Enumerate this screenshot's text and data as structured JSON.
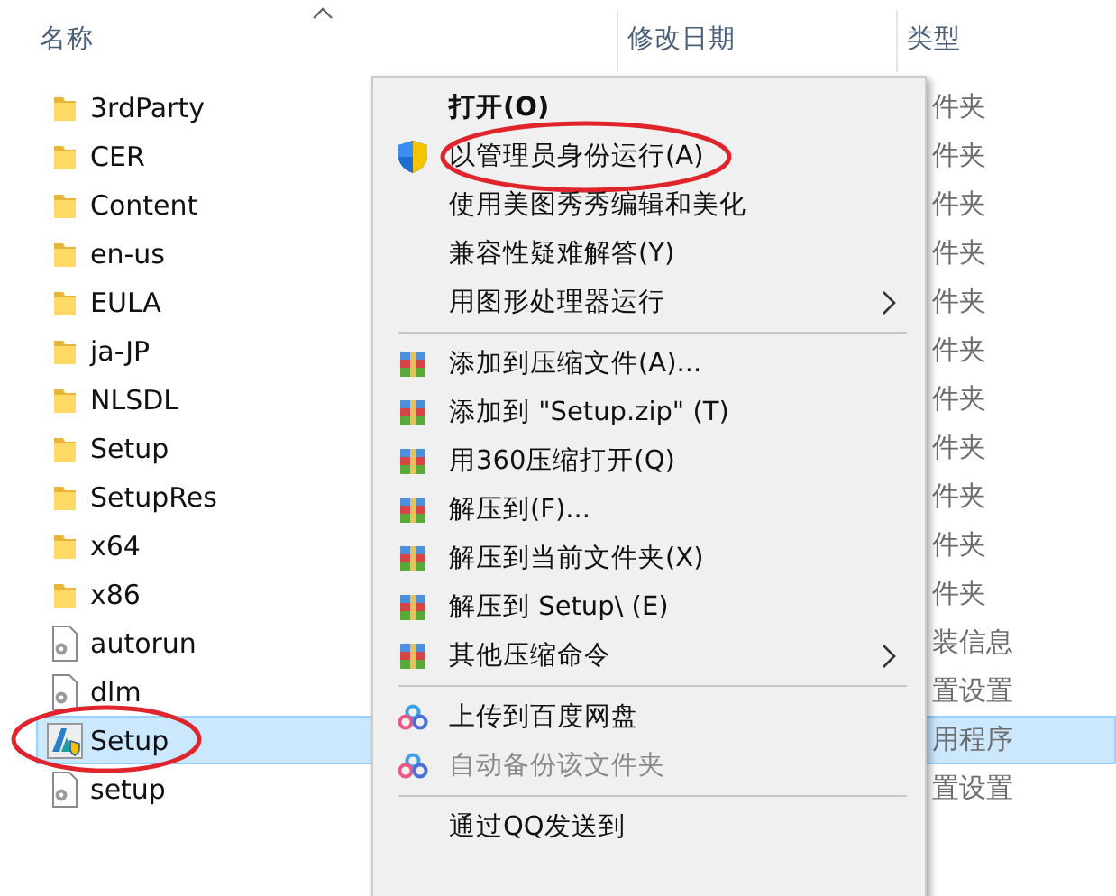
{
  "columns": [
    {
      "label": "名称",
      "sorted": true
    },
    {
      "label": "修改日期",
      "sorted": false
    },
    {
      "label": "类型",
      "sorted": false
    }
  ],
  "files": [
    {
      "kind": "folder",
      "name": "3rdParty",
      "type": "件夹",
      "selected": false,
      "circled": false
    },
    {
      "kind": "folder",
      "name": "CER",
      "type": "件夹",
      "selected": false,
      "circled": false
    },
    {
      "kind": "folder",
      "name": "Content",
      "type": "件夹",
      "selected": false,
      "circled": false
    },
    {
      "kind": "folder",
      "name": "en-us",
      "type": "件夹",
      "selected": false,
      "circled": false
    },
    {
      "kind": "folder",
      "name": "EULA",
      "type": "件夹",
      "selected": false,
      "circled": false
    },
    {
      "kind": "folder",
      "name": "ja-JP",
      "type": "件夹",
      "selected": false,
      "circled": false
    },
    {
      "kind": "folder",
      "name": "NLSDL",
      "type": "件夹",
      "selected": false,
      "circled": false
    },
    {
      "kind": "folder",
      "name": "Setup",
      "type": "件夹",
      "selected": false,
      "circled": false
    },
    {
      "kind": "folder",
      "name": "SetupRes",
      "type": "件夹",
      "selected": false,
      "circled": false
    },
    {
      "kind": "folder",
      "name": "x64",
      "type": "件夹",
      "selected": false,
      "circled": false
    },
    {
      "kind": "folder",
      "name": "x86",
      "type": "件夹",
      "selected": false,
      "circled": false
    },
    {
      "kind": "config",
      "name": "autorun",
      "type": "装信息",
      "selected": false,
      "circled": false
    },
    {
      "kind": "config",
      "name": "dlm",
      "type": "置设置",
      "selected": false,
      "circled": false
    },
    {
      "kind": "app",
      "name": "Setup",
      "type": "用程序",
      "selected": true,
      "circled": true
    },
    {
      "kind": "config",
      "name": "setup",
      "type": "置设置",
      "selected": false,
      "circled": false
    }
  ],
  "context_menu": {
    "groups": [
      [
        {
          "kind": "plain",
          "label": "打开(O)",
          "default": true,
          "disabled": false,
          "submenu": false,
          "circled": false
        },
        {
          "kind": "shield",
          "label": "以管理员身份运行(A)",
          "default": false,
          "disabled": false,
          "submenu": false,
          "circled": true
        },
        {
          "kind": "plain",
          "label": "使用美图秀秀编辑和美化",
          "default": false,
          "disabled": false,
          "submenu": false,
          "circled": false
        },
        {
          "kind": "plain",
          "label": "兼容性疑难解答(Y)",
          "default": false,
          "disabled": false,
          "submenu": false,
          "circled": false
        },
        {
          "kind": "plain",
          "label": "用图形处理器运行",
          "default": false,
          "disabled": false,
          "submenu": true,
          "circled": false
        }
      ],
      [
        {
          "kind": "archive",
          "label": "添加到压缩文件(A)...",
          "default": false,
          "disabled": false,
          "submenu": false,
          "circled": false
        },
        {
          "kind": "archive",
          "label": "添加到 \"Setup.zip\" (T)",
          "default": false,
          "disabled": false,
          "submenu": false,
          "circled": false
        },
        {
          "kind": "archive",
          "label": "用360压缩打开(Q)",
          "default": false,
          "disabled": false,
          "submenu": false,
          "circled": false
        },
        {
          "kind": "archive",
          "label": "解压到(F)...",
          "default": false,
          "disabled": false,
          "submenu": false,
          "circled": false
        },
        {
          "kind": "archive",
          "label": "解压到当前文件夹(X)",
          "default": false,
          "disabled": false,
          "submenu": false,
          "circled": false
        },
        {
          "kind": "archive",
          "label": "解压到 Setup\\ (E)",
          "default": false,
          "disabled": false,
          "submenu": false,
          "circled": false
        },
        {
          "kind": "archive",
          "label": "其他压缩命令",
          "default": false,
          "disabled": false,
          "submenu": true,
          "circled": false
        }
      ],
      [
        {
          "kind": "cloud",
          "label": "上传到百度网盘",
          "default": false,
          "disabled": false,
          "submenu": false,
          "circled": false
        },
        {
          "kind": "cloud",
          "label": "自动备份该文件夹",
          "default": false,
          "disabled": true,
          "submenu": false,
          "circled": false
        }
      ],
      [
        {
          "kind": "plain",
          "label": "通过QQ发送到",
          "default": false,
          "disabled": false,
          "submenu": false,
          "circled": false
        }
      ]
    ]
  }
}
